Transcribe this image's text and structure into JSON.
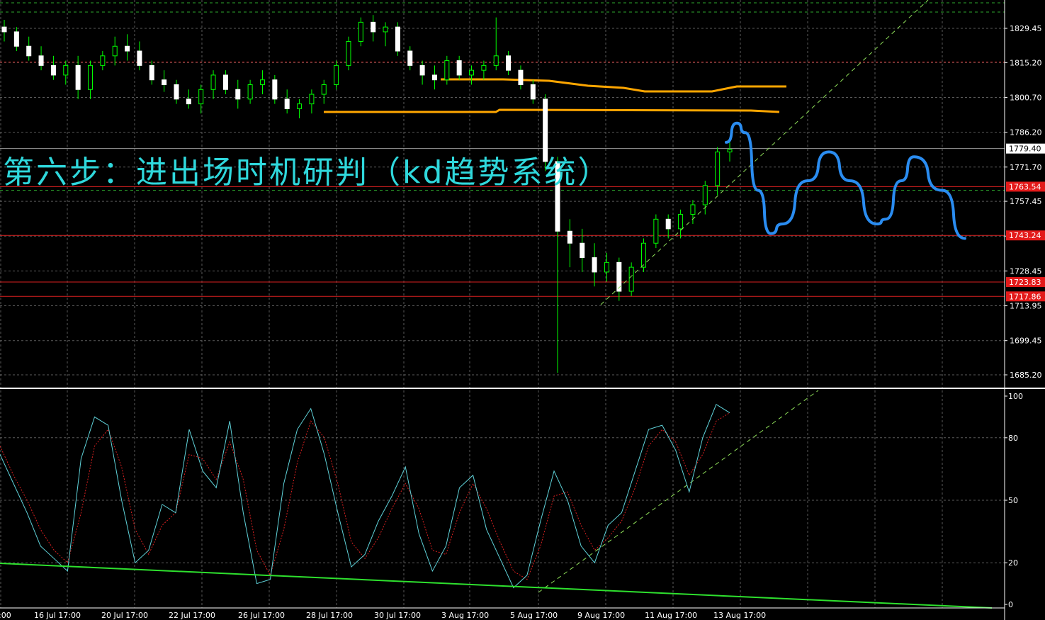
{
  "annotation": "第六步：进出场时机研判（kd趋势系统）",
  "colors": {
    "background": "#000000",
    "grid": "#5a5a5a",
    "candle_up": "#ffffff",
    "candle_down": "#ffffff",
    "wick": "#00ff00",
    "level_line": "#d92020",
    "orange_line": "#ffa600",
    "blue_projection": "#2a8cf0",
    "trend_dash": "#8fe05a",
    "k_line": "#5fd2d9",
    "d_line": "#d82020",
    "bottom_trend": "#2ee02e",
    "annotation_text": "#2fd8dc"
  },
  "chart_data": [
    {
      "type": "candlestick",
      "y_ticks": [
        "1829.45",
        "1815.20",
        "1800.70",
        "1786.20",
        "1771.70",
        "1757.45",
        "1742.95",
        "1728.45",
        "1713.95",
        "1699.45",
        "1685.20"
      ],
      "ylim": [
        1682,
        1840
      ],
      "current_price": "1779.40",
      "levels": [
        {
          "label": "1763.54",
          "value": 1763.54
        },
        {
          "label": "1743.24",
          "value": 1743.24
        },
        {
          "label": "1723.83",
          "value": 1723.83
        },
        {
          "label": "1717.86",
          "value": 1717.86
        }
      ],
      "ohlc": [
        [
          1830,
          1833,
          1824,
          1828
        ],
        [
          1828,
          1830,
          1820,
          1822
        ],
        [
          1822,
          1826,
          1816,
          1818
        ],
        [
          1818,
          1822,
          1812,
          1814
        ],
        [
          1814,
          1818,
          1808,
          1810
        ],
        [
          1810,
          1816,
          1806,
          1814
        ],
        [
          1814,
          1818,
          1800,
          1804
        ],
        [
          1804,
          1816,
          1800,
          1814
        ],
        [
          1814,
          1820,
          1812,
          1818
        ],
        [
          1818,
          1826,
          1814,
          1822
        ],
        [
          1822,
          1827,
          1816,
          1820
        ],
        [
          1820,
          1824,
          1812,
          1814
        ],
        [
          1814,
          1816,
          1806,
          1808
        ],
        [
          1808,
          1812,
          1803,
          1806
        ],
        [
          1806,
          1808,
          1798,
          1800
        ],
        [
          1800,
          1804,
          1796,
          1798
        ],
        [
          1798,
          1806,
          1794,
          1804
        ],
        [
          1804,
          1812,
          1800,
          1810
        ],
        [
          1810,
          1812,
          1802,
          1804
        ],
        [
          1804,
          1808,
          1796,
          1800
        ],
        [
          1800,
          1808,
          1798,
          1806
        ],
        [
          1806,
          1812,
          1802,
          1808
        ],
        [
          1808,
          1810,
          1798,
          1800
        ],
        [
          1800,
          1804,
          1794,
          1796
        ],
        [
          1796,
          1800,
          1792,
          1798
        ],
        [
          1798,
          1804,
          1794,
          1802
        ],
        [
          1802,
          1808,
          1798,
          1806
        ],
        [
          1806,
          1816,
          1804,
          1814
        ],
        [
          1814,
          1826,
          1812,
          1824
        ],
        [
          1824,
          1834,
          1822,
          1832
        ],
        [
          1832,
          1835,
          1824,
          1828
        ],
        [
          1828,
          1832,
          1822,
          1830
        ],
        [
          1830,
          1832,
          1818,
          1820
        ],
        [
          1820,
          1822,
          1812,
          1814
        ],
        [
          1814,
          1816,
          1806,
          1810
        ],
        [
          1810,
          1814,
          1804,
          1808
        ],
        [
          1808,
          1818,
          1806,
          1816
        ],
        [
          1816,
          1818,
          1808,
          1810
        ],
        [
          1810,
          1814,
          1806,
          1812
        ],
        [
          1812,
          1816,
          1808,
          1814
        ],
        [
          1814,
          1834,
          1812,
          1818
        ],
        [
          1818,
          1820,
          1810,
          1812
        ],
        [
          1812,
          1814,
          1804,
          1806
        ],
        [
          1806,
          1808,
          1798,
          1800
        ],
        [
          1800,
          1802,
          1770,
          1774
        ],
        [
          1774,
          1776,
          1686,
          1745
        ],
        [
          1745,
          1750,
          1730,
          1740
        ],
        [
          1740,
          1746,
          1728,
          1734
        ],
        [
          1734,
          1740,
          1722,
          1728
        ],
        [
          1728,
          1736,
          1724,
          1732
        ],
        [
          1732,
          1734,
          1716,
          1720
        ],
        [
          1720,
          1732,
          1718,
          1730
        ],
        [
          1730,
          1742,
          1728,
          1740
        ],
        [
          1740,
          1752,
          1738,
          1750
        ],
        [
          1750,
          1752,
          1742,
          1746
        ],
        [
          1746,
          1754,
          1742,
          1752
        ],
        [
          1752,
          1758,
          1748,
          1756
        ],
        [
          1756,
          1766,
          1752,
          1764
        ],
        [
          1764,
          1780,
          1760,
          1778
        ],
        [
          1778,
          1782,
          1774,
          1779
        ]
      ],
      "date_labels": [
        "16 Jul 17:00",
        "20 Jul 17:00",
        "22 Jul 17:00",
        "26 Jul 17:00",
        "28 Jul 17:00",
        "30 Jul 17:00",
        "3 Aug 17:00",
        "5 Aug 17:00",
        "9 Aug 17:00",
        "11 Aug 17:00",
        "13 Aug 17:00"
      ],
      "orange_lines": [
        [
          [
            1806.5
          ],
          [
            1806.5
          ],
          [
            1804
          ],
          [
            1803
          ],
          [
            1803
          ],
          [
            1804
          ],
          [
            1805
          ]
        ],
        [
          [
            1795
          ],
          [
            1795
          ],
          [
            1795.5
          ],
          [
            1795.5
          ],
          [
            1795.5
          ],
          [
            1795.2
          ]
        ]
      ],
      "blue_projection_prices": [
        1782,
        1790,
        1786,
        1762,
        1744,
        1748,
        1766,
        1778,
        1766,
        1748,
        1750,
        1766,
        1776,
        1762,
        1742
      ]
    },
    {
      "type": "line",
      "name": "stochastic",
      "y_ticks": [
        "100",
        "80",
        "50",
        "20",
        "0"
      ],
      "ylim": [
        0,
        100
      ],
      "k": [
        72,
        58,
        44,
        28,
        22,
        16,
        70,
        90,
        86,
        50,
        20,
        26,
        48,
        44,
        84,
        64,
        56,
        88,
        44,
        10,
        12,
        58,
        84,
        94,
        72,
        44,
        18,
        24,
        40,
        52,
        66,
        34,
        16,
        28,
        56,
        62,
        36,
        22,
        8,
        14,
        40,
        64,
        50,
        28,
        20,
        38,
        44,
        64,
        84,
        86,
        74,
        54,
        80,
        96,
        92
      ],
      "d": [
        76,
        62,
        50,
        36,
        26,
        20,
        44,
        76,
        84,
        66,
        36,
        24,
        38,
        44,
        72,
        70,
        60,
        78,
        60,
        26,
        14,
        36,
        68,
        88,
        80,
        58,
        30,
        22,
        32,
        46,
        58,
        46,
        26,
        24,
        44,
        58,
        46,
        30,
        16,
        12,
        28,
        52,
        54,
        38,
        26,
        32,
        40,
        56,
        76,
        84,
        78,
        62,
        72,
        88,
        92
      ]
    }
  ]
}
